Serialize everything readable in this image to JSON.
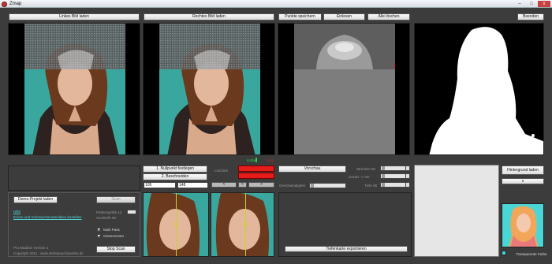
{
  "window": {
    "title": "Zmap",
    "minimize": "–",
    "maximize": "□",
    "close": "x"
  },
  "toolbar": {
    "load_left": "Linkes Bild laden",
    "load_right": "Rechtes Bild laden",
    "save_points": "Punkte speichern",
    "load_points": "Einlesen",
    "delete_all": "Alle löschen",
    "quit": "Beenden"
  },
  "indicators": {
    "left_status": "Kolbe",
    "right_status": "Vorn"
  },
  "point_tools": {
    "set_zero": "1. Nullpunkt festlegen",
    "crop": "2. Beschneiden",
    "coord_x": "105",
    "coord_y": "148",
    "delete_label": "Löschen",
    "nav_left": "<",
    "nav_mid": "<",
    "nav_right": ">"
  },
  "preview": {
    "button": "Vorschau",
    "speed_label": "Geschwindigkeit",
    "stretch_label": "Strecken 90",
    "zoom_label": "Zusatz -> Ver",
    "depth_label": "Tiefe 90",
    "export": "Tiefenkarte exportieren"
  },
  "background": {
    "load": "Hintergrund laden",
    "remove": "x",
    "transparent_label": "Transparente Farbe"
  },
  "scan": {
    "demo_load": "Demo-Projekt laden",
    "scan_btn": "Scan",
    "help_link": "Hilfe",
    "tutorial_link": "Ecken und Vorbrauchsmaterialien bestellen",
    "pattern_size_label": "Patterngröße 12",
    "search_depth_label": "Suchtiefe 90",
    "multi_pass": "Multi Pass",
    "green_screen": "Greenscreen",
    "stop": "Stop Scan"
  },
  "footer": {
    "version": "Pro Maddox Version 1",
    "copyright": "Copyright 2011 · www.stefanlauchswerke.de"
  },
  "colors": {
    "background": "#3c3c3c",
    "teal_backdrop": "#3aa79f",
    "delete_red": "#e81b1b",
    "indicator_green": "#1ed24a",
    "indicator_red": "#d82020",
    "link": "#4fd3d3"
  }
}
